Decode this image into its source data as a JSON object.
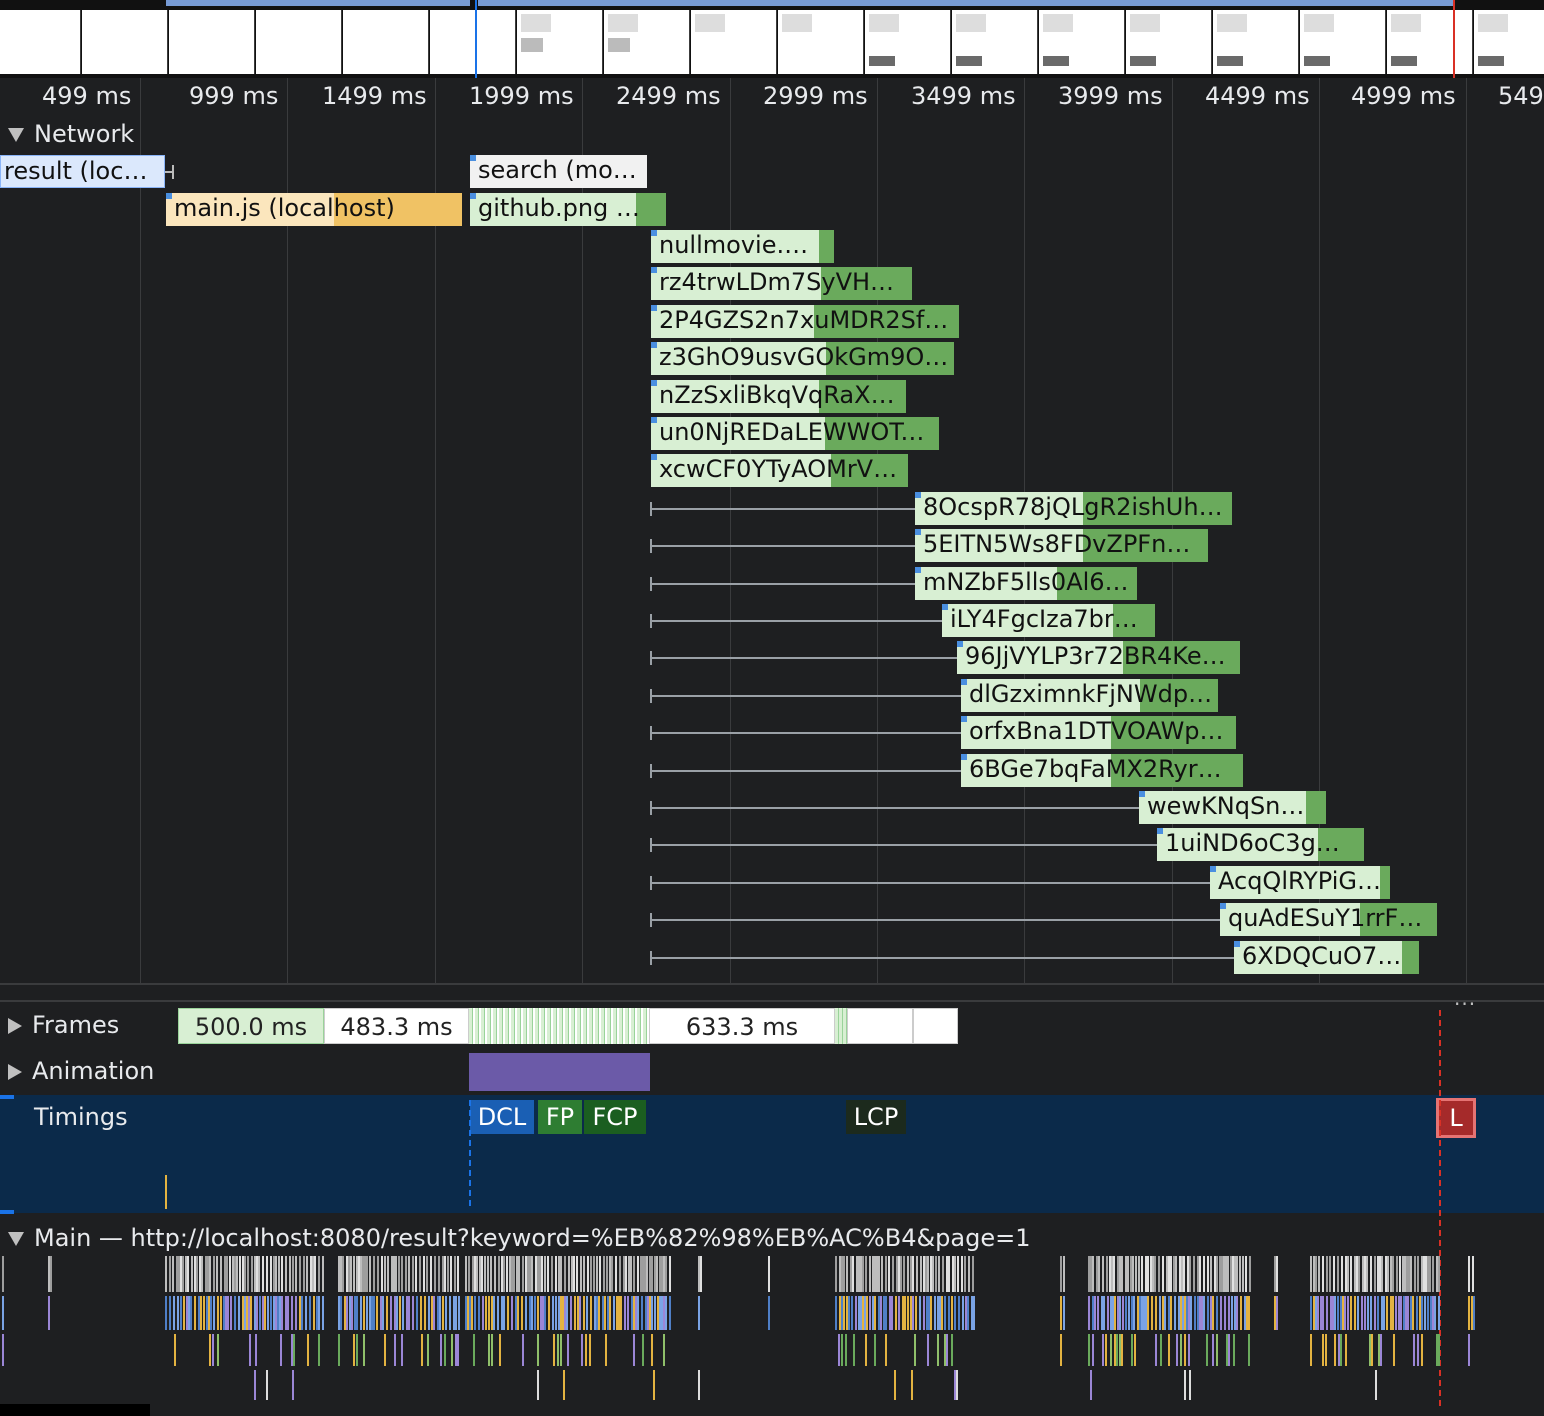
{
  "ruler": {
    "ticks": [
      "499 ms",
      "999 ms",
      "1499 ms",
      "1999 ms",
      "2499 ms",
      "2999 ms",
      "3499 ms",
      "3999 ms",
      "4499 ms",
      "4999 ms",
      "549"
    ]
  },
  "tracks": {
    "network": "Network",
    "frames": "Frames",
    "animation": "Animation",
    "timings": "Timings",
    "main": "Main — http://localhost:8080/result?keyword=%EB%82%98%EB%AC%B4&page=1"
  },
  "requests": [
    {
      "label": "result (loc…"
    },
    {
      "label": "main.js (localhost)"
    },
    {
      "label": "search (mo…"
    },
    {
      "label": "github.png (l…"
    },
    {
      "label": "nullmovie.w…"
    },
    {
      "label": "rz4trwLDm7SyVHK…"
    },
    {
      "label": "2P4GZS2n7xuMDR2Sf…"
    },
    {
      "label": "z3GhO9usvGOkGm9O…"
    },
    {
      "label": "nZzSxliBkqVqRaX…"
    },
    {
      "label": "un0NjREDaLEWWOTr…"
    },
    {
      "label": "xcwCF0YTyAOMrV…"
    },
    {
      "label": "8OcspR78jQLgR2ishUh…"
    },
    {
      "label": "5EITN5Ws8FDvZPFn7…"
    },
    {
      "label": "mNZbF5lls0Al6…"
    },
    {
      "label": "iLY4FgcIza7br…"
    },
    {
      "label": "96JjVYLP3r72BR4Ke…"
    },
    {
      "label": "dlGzximnkFjNWdp…"
    },
    {
      "label": "orfxBna1DTVOAWp…"
    },
    {
      "label": "6BGe7bqFaMX2RyrB…"
    },
    {
      "label": "wewKNqSnC…"
    },
    {
      "label": "1uiND6oC3g…"
    },
    {
      "label": "AcqQlRYPiG…"
    },
    {
      "label": "quAdESuY1rrF…"
    },
    {
      "label": "6XDQCuO7…"
    }
  ],
  "frames": [
    "500.0 ms",
    "483.3 ms",
    "633.3 ms"
  ],
  "timings": {
    "dcl": "DCL",
    "fp": "FP",
    "fcp": "FCP",
    "lcp": "LCP",
    "l": "L"
  },
  "colors": {
    "doc": "#a8c7fa",
    "script": "#f0c264",
    "image_wait": "#d8efd3",
    "image_dl": "#6aaa5c",
    "timings_bg": "#0b2a4a",
    "animation": "#6b5aa8"
  },
  "more_menu": "..."
}
